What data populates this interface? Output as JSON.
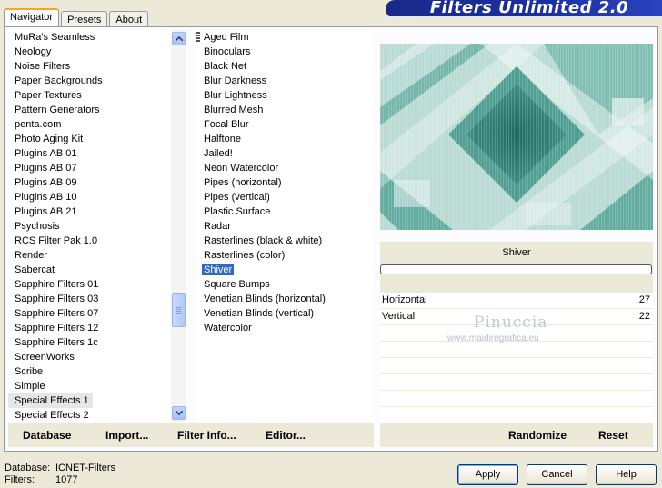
{
  "app_banner": "Filters Unlimited 2.0",
  "tabs": [
    {
      "label": "Navigator",
      "active": true
    },
    {
      "label": "Presets",
      "active": false
    },
    {
      "label": "About",
      "active": false
    }
  ],
  "categories": {
    "items": [
      "MuRa's Seamless",
      "Neology",
      "Noise Filters",
      "Paper Backgrounds",
      "Paper Textures",
      "Pattern Generators",
      "penta.com",
      "Photo Aging Kit",
      "Plugins AB 01",
      "Plugins AB 07",
      "Plugins AB 09",
      "Plugins AB 10",
      "Plugins AB 21",
      "Psychosis",
      "RCS Filter Pak 1.0",
      "Render",
      "Sabercat",
      "Sapphire Filters 01",
      "Sapphire Filters 03",
      "Sapphire Filters 07",
      "Sapphire Filters 12",
      "Sapphire Filters 1c",
      "ScreenWorks",
      "Scribe",
      "Simple",
      "Special Effects 1",
      "Special Effects 2"
    ],
    "selected": "Special Effects 1",
    "scroll_position": 0.72
  },
  "filters": {
    "items": [
      "Aged Film",
      "Binoculars",
      "Black Net",
      "Blur Darkness",
      "Blur Lightness",
      "Blurred Mesh",
      "Focal Blur",
      "Halftone",
      "Jailed!",
      "Neon Watercolor",
      "Pipes (horizontal)",
      "Pipes (vertical)",
      "Plastic Surface",
      "Radar",
      "Rasterlines (black & white)",
      "Rasterlines (color)",
      "Shiver",
      "Square Bumps",
      "Venetian Blinds (horizontal)",
      "Venetian Blinds (vertical)",
      "Watercolor"
    ],
    "selected": "Shiver"
  },
  "preview": {
    "filter_name": "Shiver",
    "colors": {
      "teal_dark": "#2e7a6e",
      "teal_mid": "#5aa89b",
      "teal_light": "#a9d3cb",
      "highlight": "#eef4f3"
    }
  },
  "parameters": [
    {
      "label": "Horizontal",
      "value": "27"
    },
    {
      "label": "Vertical",
      "value": "22"
    }
  ],
  "watermark": {
    "name": "Pinuccia",
    "url": "www.maidiregrafica.eu"
  },
  "left_toolbar": {
    "database": "Database",
    "import": "Import...",
    "filter_info": "Filter Info...",
    "editor": "Editor..."
  },
  "right_toolbar": {
    "randomize": "Randomize",
    "reset": "Reset"
  },
  "status": {
    "database_label": "Database:",
    "database_value": "ICNET-Filters",
    "filters_label": "Filters:",
    "filters_value": "1077"
  },
  "dialog_buttons": {
    "apply": "Apply",
    "cancel": "Cancel",
    "help": "Help"
  }
}
